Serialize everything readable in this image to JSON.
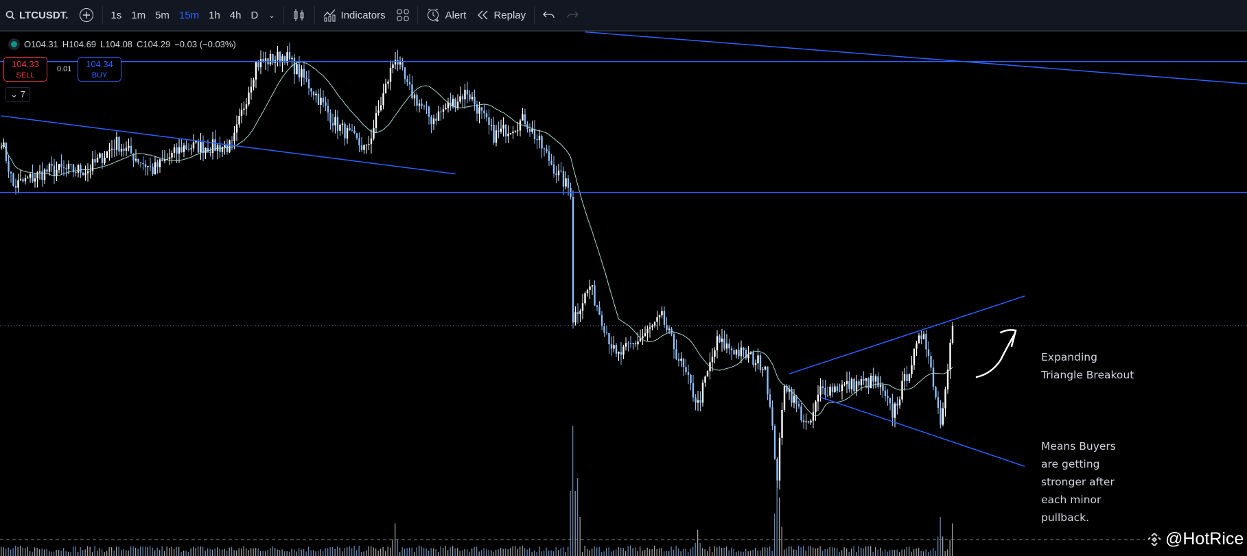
{
  "toolbar": {
    "symbol": "LTCUSDT.",
    "intervals": [
      "1s",
      "1m",
      "5m",
      "15m",
      "1h",
      "4h",
      "D"
    ],
    "active_interval": "15m",
    "indicators_label": "Indicators",
    "alert_label": "Alert",
    "replay_label": "Replay"
  },
  "legend": {
    "open": "O104.31",
    "high": "H104.69",
    "low": "L104.08",
    "close": "C104.29",
    "change": "−0.03 (−0.03%)"
  },
  "trade": {
    "sell_price": "104.33",
    "sell_label": "SELL",
    "spread": "0.01",
    "buy_price": "104.34",
    "buy_label": "BUY",
    "collapse_label": "7"
  },
  "annotation": {
    "title": "Expanding\nTriangle Breakout",
    "body": "Means Buyers\nare getting\nstronger after\neach minor\npullback."
  },
  "watermark": "@HotRice",
  "colors": {
    "up": "#ffffff",
    "down": "#90bff9",
    "ma": "#a8d5cf",
    "drawing": "#2962ff",
    "sell": "#f23645",
    "buy": "#2962ff"
  },
  "chart_data": {
    "type": "candlestick",
    "symbol": "LTCUSDT",
    "interval": "15m",
    "last_price": 104.29,
    "anchors": [
      [
        0,
        105.8
      ],
      [
        5,
        105.42
      ],
      [
        20,
        105.55
      ],
      [
        36,
        105.55
      ],
      [
        48,
        105.77
      ],
      [
        63,
        105.55
      ],
      [
        76,
        105.74
      ],
      [
        96,
        105.74
      ],
      [
        106,
        106.41
      ],
      [
        118,
        106.48
      ],
      [
        129,
        106.22
      ],
      [
        139,
        105.93
      ],
      [
        152,
        105.71
      ],
      [
        157,
        106.03
      ],
      [
        164,
        106.48
      ],
      [
        169,
        106.22
      ],
      [
        179,
        105.96
      ],
      [
        194,
        106.19
      ],
      [
        205,
        105.83
      ],
      [
        218,
        105.96
      ],
      [
        232,
        105.51
      ],
      [
        237,
        105.38
      ],
      [
        238,
        104.35
      ],
      [
        245,
        104.61
      ],
      [
        256,
        104.03
      ],
      [
        268,
        104.22
      ],
      [
        275,
        104.35
      ],
      [
        290,
        103.65
      ],
      [
        298,
        104.16
      ],
      [
        318,
        103.97
      ],
      [
        323,
        103.07
      ],
      [
        326,
        103.84
      ],
      [
        336,
        103.45
      ],
      [
        341,
        103.77
      ],
      [
        364,
        103.84
      ],
      [
        371,
        103.58
      ],
      [
        384,
        104.26
      ],
      [
        391,
        103.52
      ],
      [
        396,
        104.29
      ]
    ],
    "volume_spikes": [
      [
        238,
        1.0
      ],
      [
        240,
        0.6
      ],
      [
        323,
        0.65
      ],
      [
        324,
        0.45
      ],
      [
        391,
        0.3
      ],
      [
        396,
        0.25
      ],
      [
        164,
        0.25
      ],
      [
        290,
        0.2
      ]
    ],
    "drawings": [
      {
        "type": "trendline",
        "from": [
          243,
          106.67
        ],
        "to": [
          519,
          106.25
        ]
      },
      {
        "type": "horizontal",
        "price": 106.43
      },
      {
        "type": "horizontal",
        "price": 105.37
      },
      {
        "type": "trendline",
        "from": [
          0,
          105.99
        ],
        "to": [
          189,
          105.52
        ]
      },
      {
        "type": "trendline",
        "from": [
          328,
          103.9
        ],
        "to": [
          426,
          104.53
        ]
      },
      {
        "type": "trendline",
        "from": [
          341,
          103.71
        ],
        "to": [
          426,
          103.15
        ]
      }
    ]
  }
}
